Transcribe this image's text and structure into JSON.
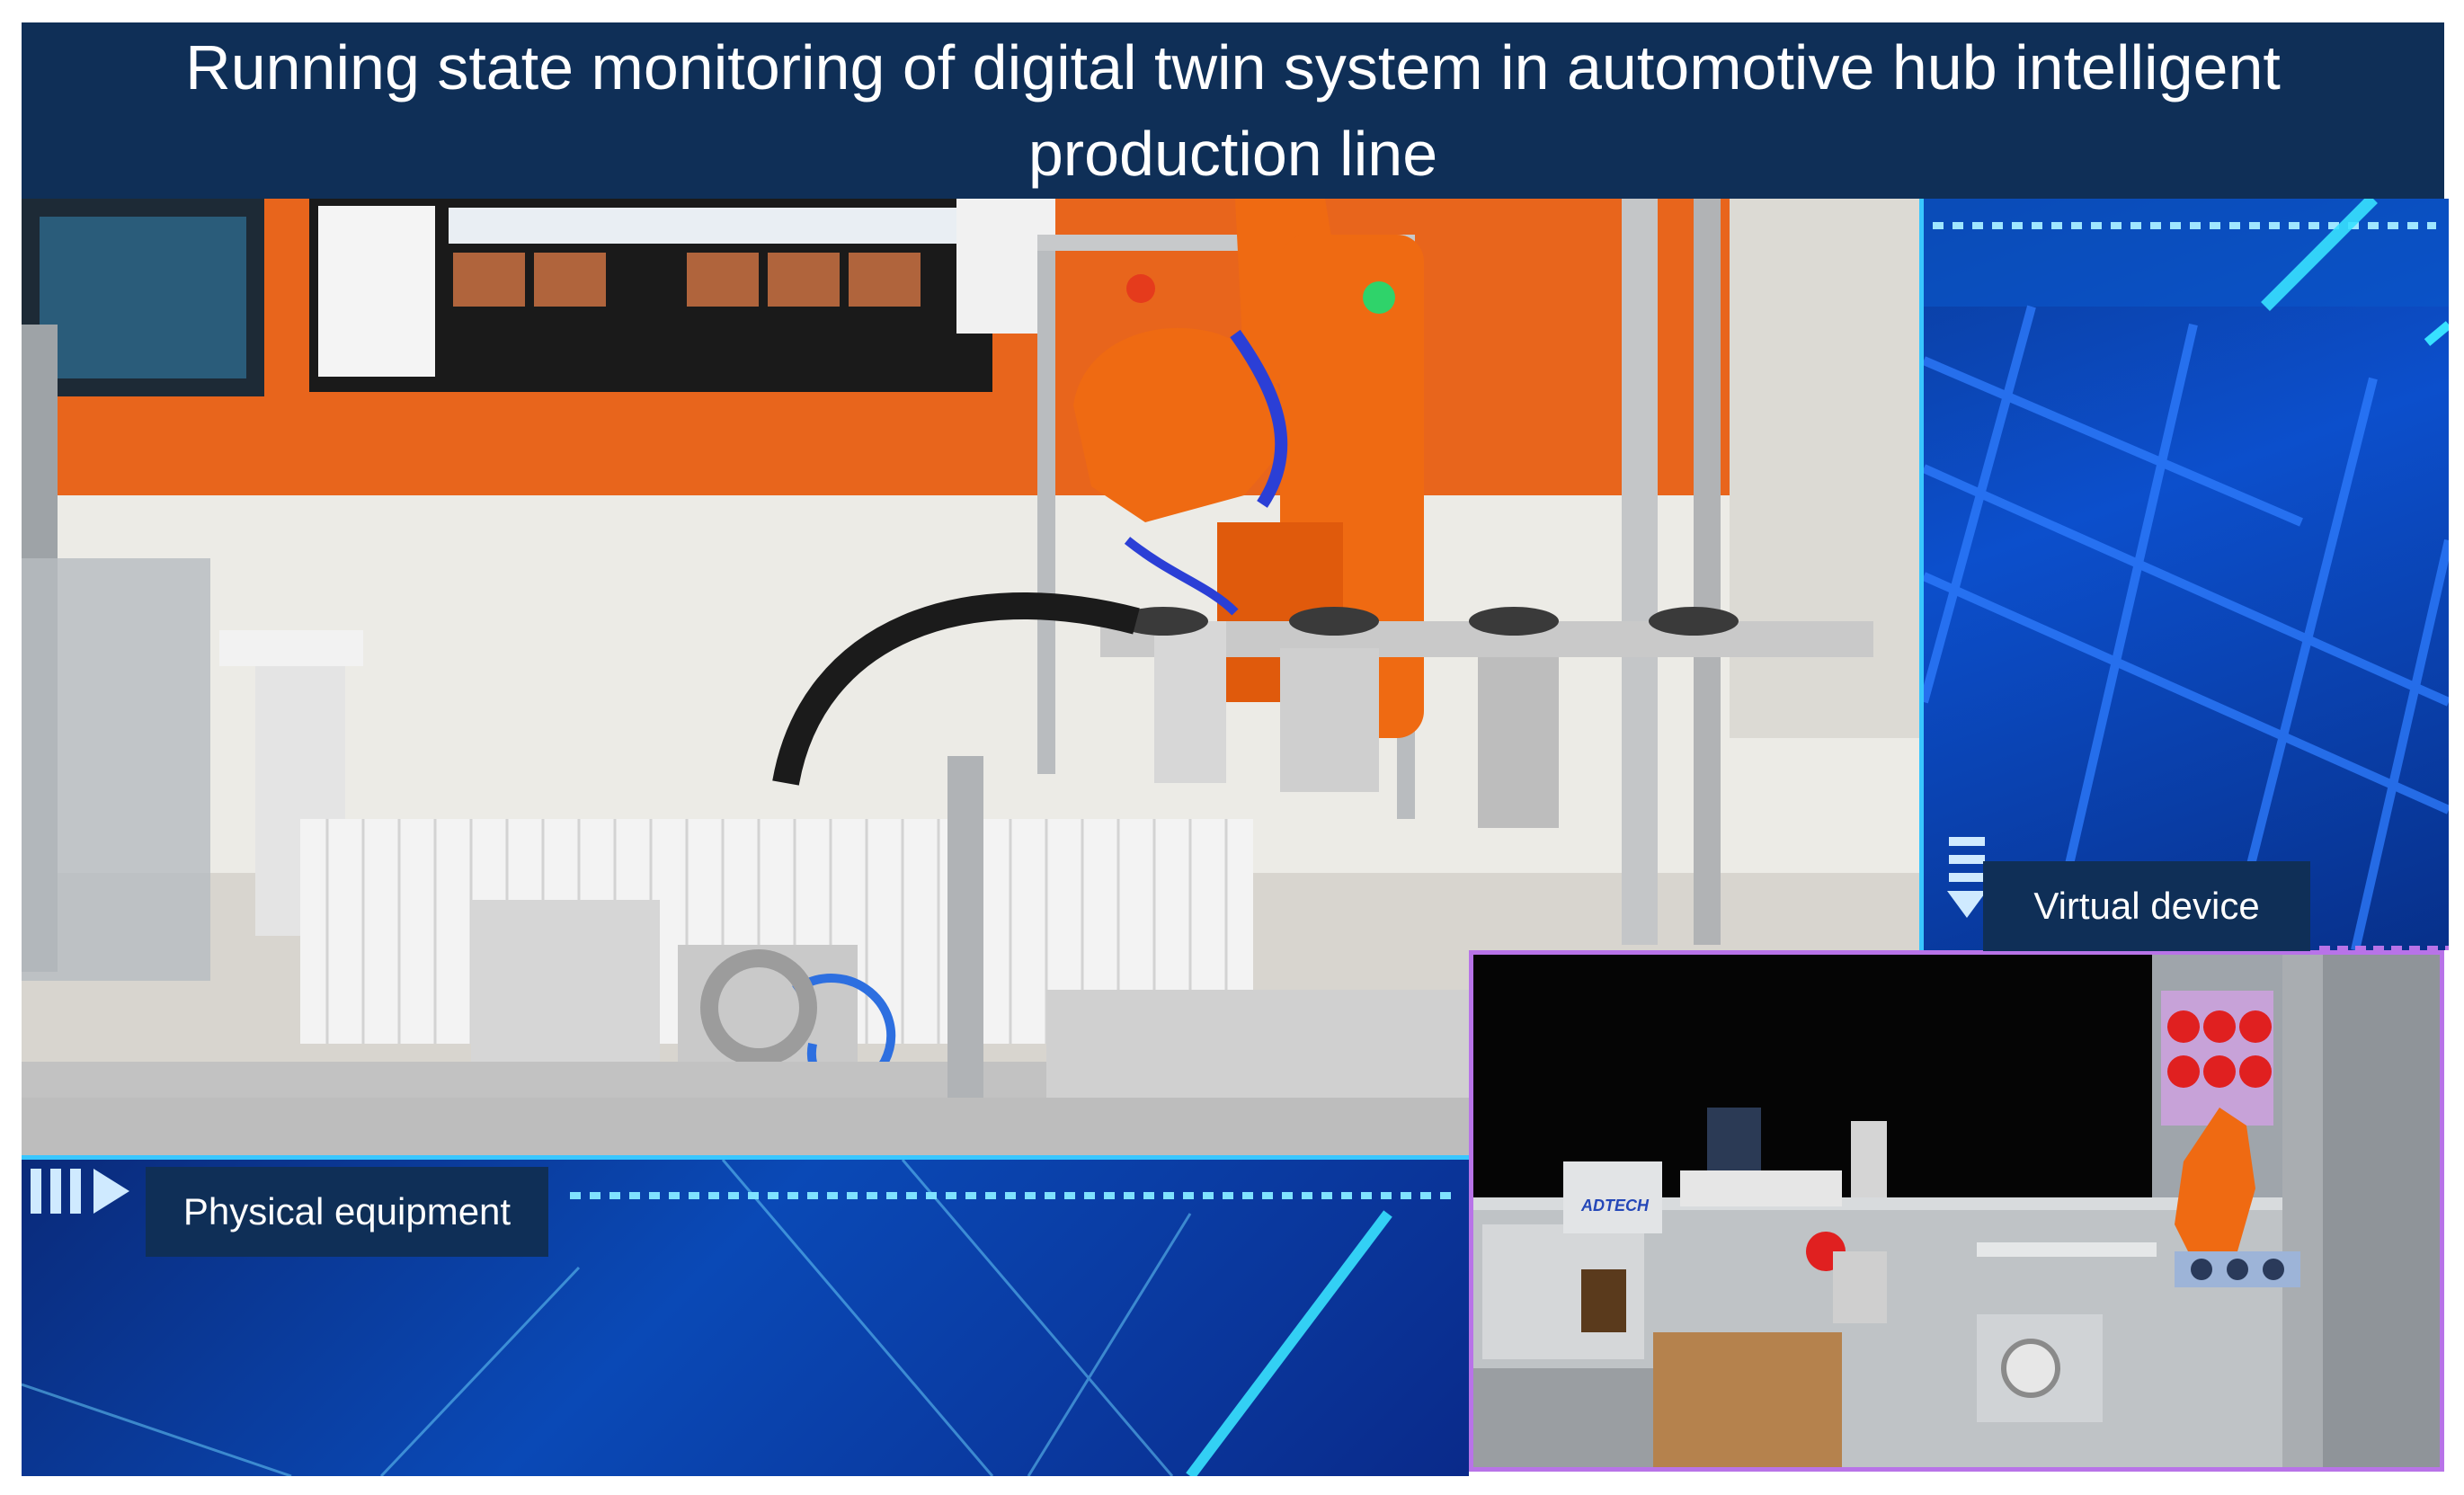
{
  "title": "Running state monitoring of digital twin system in automotive hub intelligent production line",
  "labels": {
    "physical": "Physical equipment",
    "virtual": "Virtual device"
  },
  "virtual_logo": "ADTECH",
  "colors": {
    "banner": "#0f2f57",
    "robot_orange": "#ef6a12",
    "panel_blue": "#0a49b6",
    "accent_cyan": "#39c7ff",
    "accent_purple": "#b873e8"
  }
}
